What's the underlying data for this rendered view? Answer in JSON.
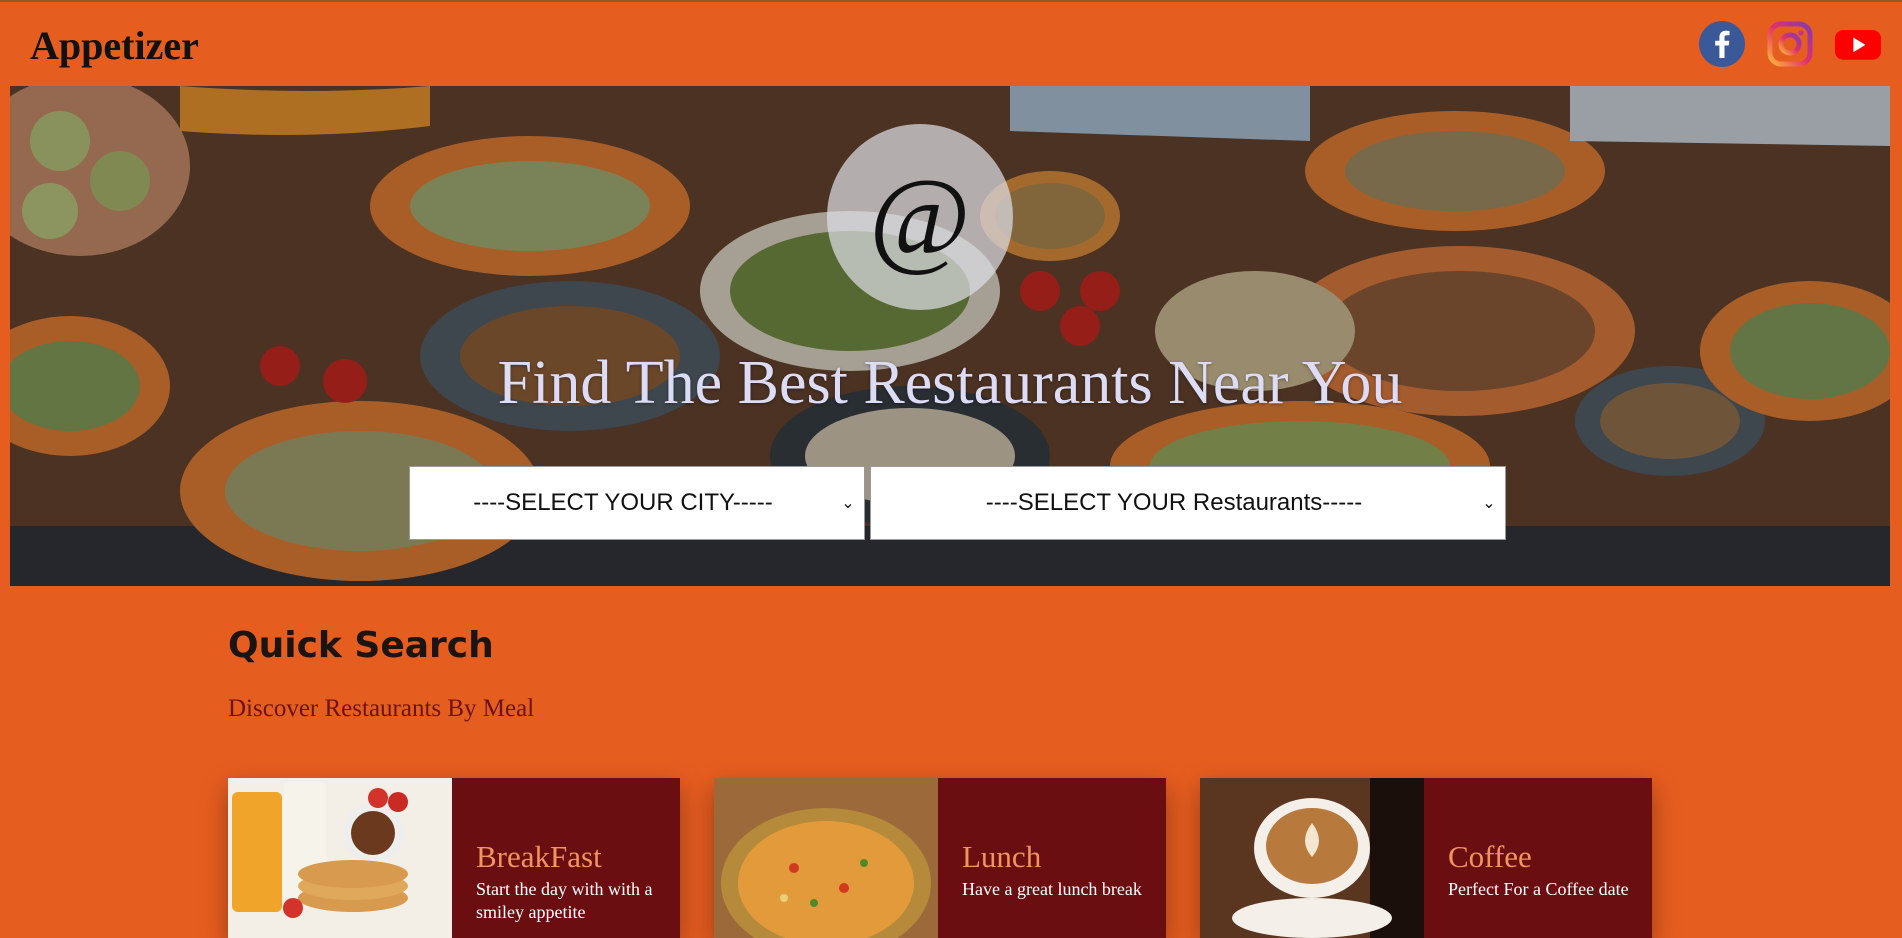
{
  "header": {
    "brand": "Appetizer",
    "social": [
      {
        "name": "facebook-icon",
        "color": "#3b5998"
      },
      {
        "name": "instagram-icon",
        "color": "#e1306c"
      },
      {
        "name": "youtube-icon",
        "color": "#ff0000"
      }
    ]
  },
  "hero": {
    "logo_symbol": "@",
    "title": "Find The Best Restaurants Near You",
    "city_select": {
      "selected": "----SELECT YOUR CITY-----"
    },
    "restaurant_select": {
      "selected": "----SELECT YOUR Restaurants-----"
    }
  },
  "quick_search": {
    "title": "Quick Search",
    "subtitle": "Discover Restaurants By Meal",
    "cards": [
      {
        "title": "BreakFast",
        "desc": "Start the day with with a smiley appetite"
      },
      {
        "title": "Lunch",
        "desc": "Have a great lunch break"
      },
      {
        "title": "Coffee",
        "desc": "Perfect For a Coffee date"
      }
    ]
  },
  "colors": {
    "page_bg": "#e65d20",
    "card_bg": "#6b0e12",
    "card_title": "#f0955f",
    "hero_title": "#dcdcf6"
  }
}
